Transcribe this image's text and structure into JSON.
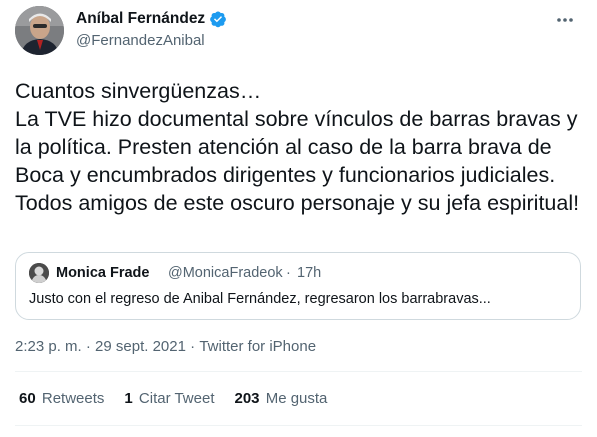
{
  "author": {
    "display_name": "Aníbal Fernández",
    "handle": "@FernandezAnibal",
    "verified": true,
    "verified_color": "#1d9bf0"
  },
  "tweet": {
    "text": "Cuantos sinvergüenzas…\nLa TVE hizo documental sobre vínculos de barras bravas y la política. Presten atención al caso de la barra brava de Boca y encumbrados dirigentes y funcionarios judiciales. Todos amigos de este oscuro personaje y su jefa espiritual!"
  },
  "quoted": {
    "display_name": "Monica Frade",
    "handle": "@MonicaFradeok",
    "separator": "·",
    "time": "17h",
    "text": "Justo con el regreso de Anibal Fernández, regresaron los barrabravas..."
  },
  "meta": {
    "time": "2:23 p. m.",
    "separator1": " · ",
    "date": "29 sept. 2021",
    "separator2": " · ",
    "source": "Twitter for iPhone"
  },
  "stats": {
    "retweets_count": "60",
    "retweets_label": "Retweets",
    "quotes_count": "1",
    "quotes_label": "Citar Tweet",
    "likes_count": "203",
    "likes_label": "Me gusta"
  },
  "icons": {
    "more": "more-options-icon",
    "verified": "verified-badge-icon"
  }
}
